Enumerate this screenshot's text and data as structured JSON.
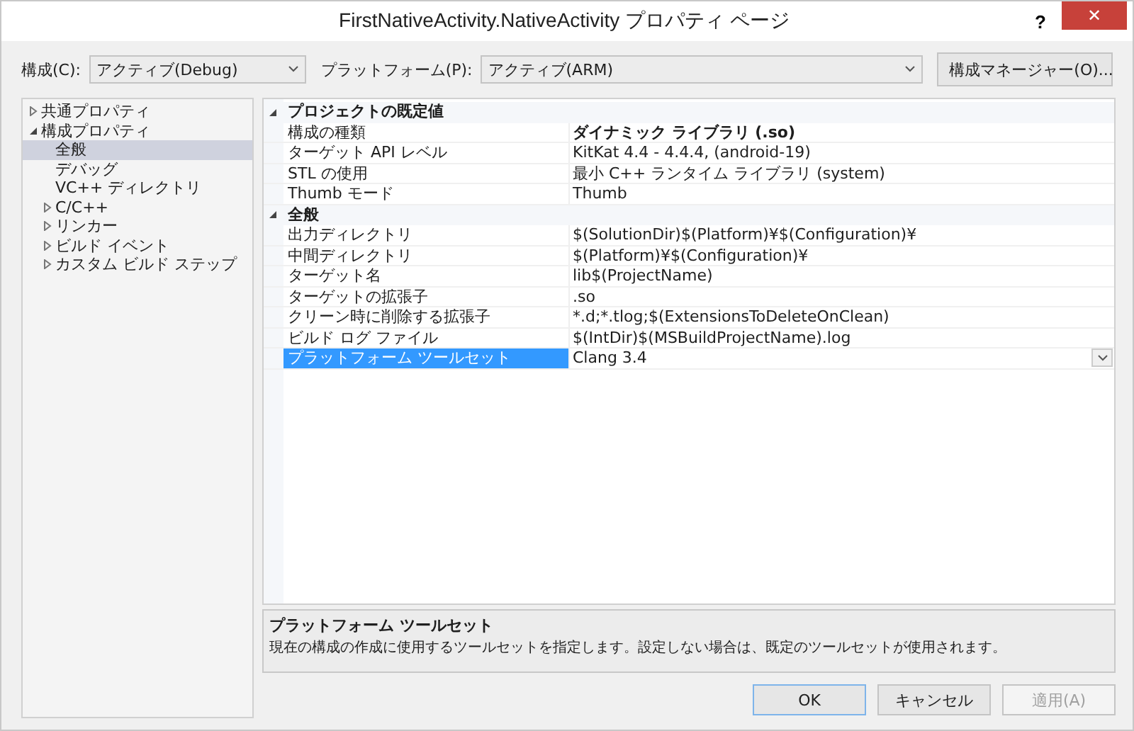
{
  "window": {
    "title": "FirstNativeActivity.NativeActivity プロパティ ページ",
    "help": "?",
    "close": "✕"
  },
  "toolbar": {
    "configuration": {
      "label": "構成(C):",
      "value": "アクティブ(Debug)"
    },
    "platform": {
      "label": "プラットフォーム(P):",
      "value": "アクティブ(ARM)"
    },
    "manager_button": "構成マネージャー(O)..."
  },
  "tree": [
    {
      "label": "共通プロパティ",
      "expanded": false,
      "selected": false
    },
    {
      "label": "構成プロパティ",
      "expanded": true,
      "selected": false,
      "children": [
        {
          "label": "全般",
          "selected": true
        },
        {
          "label": "デバッグ",
          "selected": false
        },
        {
          "label": "VC++ ディレクトリ",
          "selected": false
        },
        {
          "label": "C/C++",
          "expanded": false,
          "selected": false
        },
        {
          "label": "リンカー",
          "expanded": false,
          "selected": false
        },
        {
          "label": "ビルド イベント",
          "expanded": false,
          "selected": false
        },
        {
          "label": "カスタム ビルド ステップ",
          "expanded": false,
          "selected": false
        }
      ]
    }
  ],
  "grid": [
    {
      "category": "プロジェクトの既定値",
      "expanded": true,
      "rows": [
        {
          "name": "構成の種類",
          "value": "ダイナミック ライブラリ (.so)",
          "bold": true,
          "selected": false
        },
        {
          "name": "ターゲット API レベル",
          "value": "KitKat 4.4 - 4.4.4, (android-19)",
          "bold": false,
          "selected": false
        },
        {
          "name": "STL の使用",
          "value": "最小 C++ ランタイム ライブラリ (system)",
          "bold": false,
          "selected": false
        },
        {
          "name": "Thumb モード",
          "value": "Thumb",
          "bold": false,
          "selected": false
        }
      ]
    },
    {
      "category": "全般",
      "expanded": true,
      "rows": [
        {
          "name": "出力ディレクトリ",
          "value": "$(SolutionDir)$(Platform)¥$(Configuration)¥",
          "bold": false,
          "selected": false
        },
        {
          "name": "中間ディレクトリ",
          "value": "$(Platform)¥$(Configuration)¥",
          "bold": false,
          "selected": false
        },
        {
          "name": "ターゲット名",
          "value": "lib$(ProjectName)",
          "bold": false,
          "selected": false
        },
        {
          "name": "ターゲットの拡張子",
          "value": ".so",
          "bold": false,
          "selected": false
        },
        {
          "name": "クリーン時に削除する拡張子",
          "value": "*.d;*.tlog;$(ExtensionsToDeleteOnClean)",
          "bold": false,
          "selected": false
        },
        {
          "name": "ビルド ログ ファイル",
          "value": "$(IntDir)$(MSBuildProjectName).log",
          "bold": false,
          "selected": false
        },
        {
          "name": "プラットフォーム ツールセット",
          "value": "Clang 3.4",
          "bold": false,
          "selected": true
        }
      ]
    }
  ],
  "description": {
    "title": "プラットフォーム ツールセット",
    "text": "現在の構成の作成に使用するツールセットを指定します。設定しない場合は、既定のツールセットが使用されます。"
  },
  "buttons": [
    {
      "label": "OK",
      "disabled": false,
      "default": true
    },
    {
      "label": "キャンセル",
      "disabled": false,
      "default": false
    },
    {
      "label": "適用(A)",
      "disabled": true,
      "default": false
    }
  ]
}
